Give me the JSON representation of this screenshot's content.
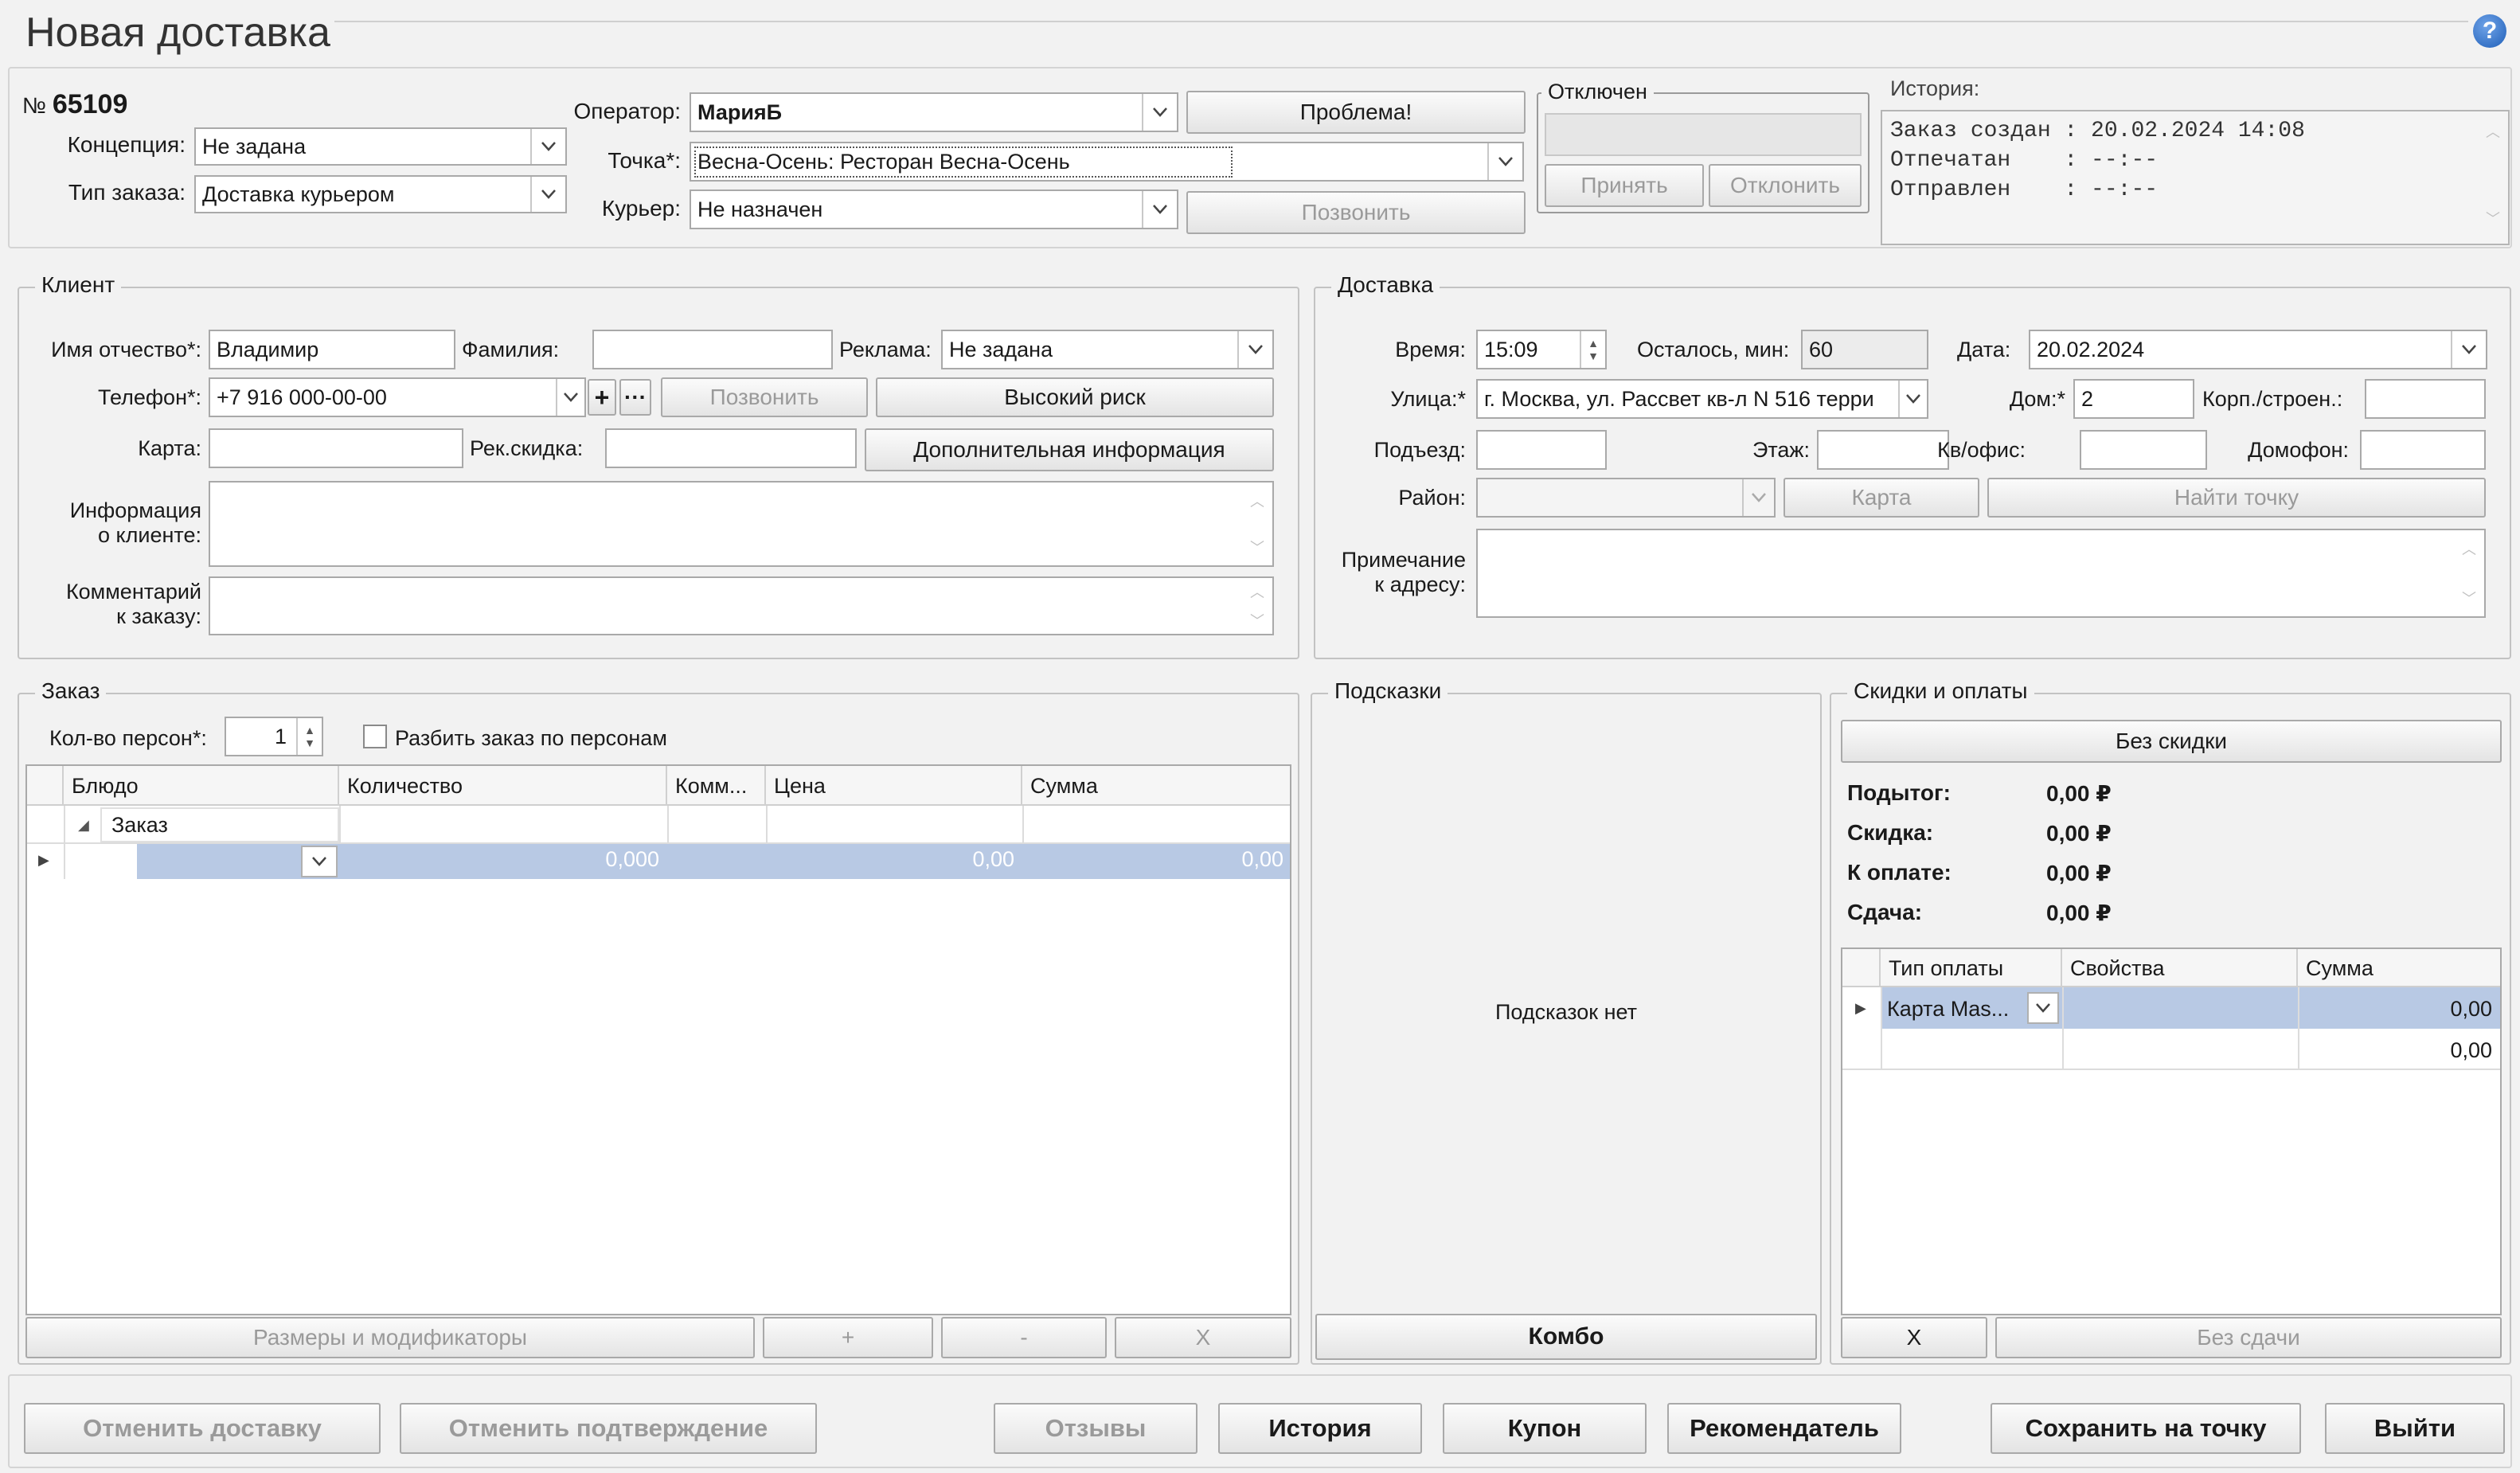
{
  "title": "Новая доставка",
  "order_no_prefix": "№",
  "order_no": "65109",
  "header": {
    "concept_label": "Концепция:",
    "concept_value": "Не задана",
    "order_type_label": "Тип заказа:",
    "order_type_value": "Доставка курьером",
    "operator_label": "Оператор:",
    "operator_value": "МарияБ",
    "point_label": "Точка*:",
    "point_value": "Весна-Осень: Ресторан Весна-Осень",
    "courier_label": "Курьер:",
    "courier_value": "Не назначен",
    "problem_btn": "Проблема!",
    "call_btn": "Позвонить",
    "disabled_group": "Отключен",
    "accept_btn": "Принять",
    "reject_btn": "Отклонить",
    "history_label": "История:",
    "history_lines": [
      "Заказ создан : 20.02.2024 14:08",
      "Отпечатан    : --:--",
      "Отправлен    : --:--"
    ]
  },
  "client": {
    "group": "Клиент",
    "first_name_label": "Имя отчество*:",
    "first_name": "Владимир",
    "last_name_label": "Фамилия:",
    "last_name": "",
    "ad_label": "Реклама:",
    "ad_value": "Не задана",
    "phone_label": "Телефон*:",
    "phone": "+7 916 000-00-00",
    "plus": "+",
    "more": "···",
    "call_btn": "Позвонить",
    "high_risk_btn": "Высокий риск",
    "card_label": "Карта:",
    "card_value": "",
    "discount_label": "Рек.скидка:",
    "discount_value": "",
    "extra_info_btn": "Дополнительная информация",
    "info_label_1": "Информация",
    "info_label_2": "о клиенте:",
    "comment_label_1": "Комментарий",
    "comment_label_2": "к заказу:"
  },
  "delivery": {
    "group": "Доставка",
    "time_label": "Время:",
    "time": "15:09",
    "left_label": "Осталось, мин:",
    "left": "60",
    "date_label": "Дата:",
    "date": "20.02.2024",
    "street_label": "Улица:*",
    "street": "г. Москва, ул. Рассвет кв-л N 516 терри",
    "house_label": "Дом:*",
    "house": "2",
    "building_label": "Корп./строен.:",
    "building": "",
    "entrance_label": "Подъезд:",
    "floor_label": "Этаж:",
    "flat_label": "Кв/офис:",
    "intercom_label": "Домофон:",
    "district_label": "Район:",
    "map_btn": "Карта",
    "find_point_btn": "Найти точку",
    "note_label_1": "Примечание",
    "note_label_2": "к адресу:"
  },
  "order": {
    "group": "Заказ",
    "persons_label": "Кол-во персон*:",
    "persons": "1",
    "split_label": "Разбить заказ по персонам",
    "columns": [
      "Блюдо",
      "Количество",
      "Комм...",
      "Цена",
      "Сумма"
    ],
    "group_row": "Заказ",
    "row_qty": "0,000",
    "row_price": "0,00",
    "row_sum": "0,00",
    "sizes_btn": "Размеры и модификаторы",
    "plus_btn": "+",
    "minus_btn": "-",
    "x_btn": "X"
  },
  "hints": {
    "group": "Подсказки",
    "empty": "Подсказок нет",
    "combo_btn": "Комбо"
  },
  "payments": {
    "group": "Скидки и оплаты",
    "no_discount_btn": "Без скидки",
    "subtotal_label": "Подытог:",
    "subtotal": "0,00 ₽",
    "discount_label": "Скидка:",
    "discount": "0,00 ₽",
    "to_pay_label": "К оплате:",
    "to_pay": "0,00 ₽",
    "change_label": "Сдача:",
    "change": "0,00 ₽",
    "columns": [
      "Тип оплаты",
      "Свойства",
      "Сумма"
    ],
    "row1_type": "Карта Mas...",
    "row1_sum": "0,00",
    "row2_sum": "0,00",
    "x_btn": "X",
    "no_change_btn": "Без сдачи"
  },
  "footer": {
    "cancel_delivery": "Отменить доставку",
    "cancel_confirm": "Отменить подтверждение",
    "reviews": "Отзывы",
    "history": "История",
    "coupon": "Купон",
    "recommender": "Рекомендатель",
    "save_to_point": "Сохранить на точку",
    "exit": "Выйти"
  },
  "help_icon": "?"
}
